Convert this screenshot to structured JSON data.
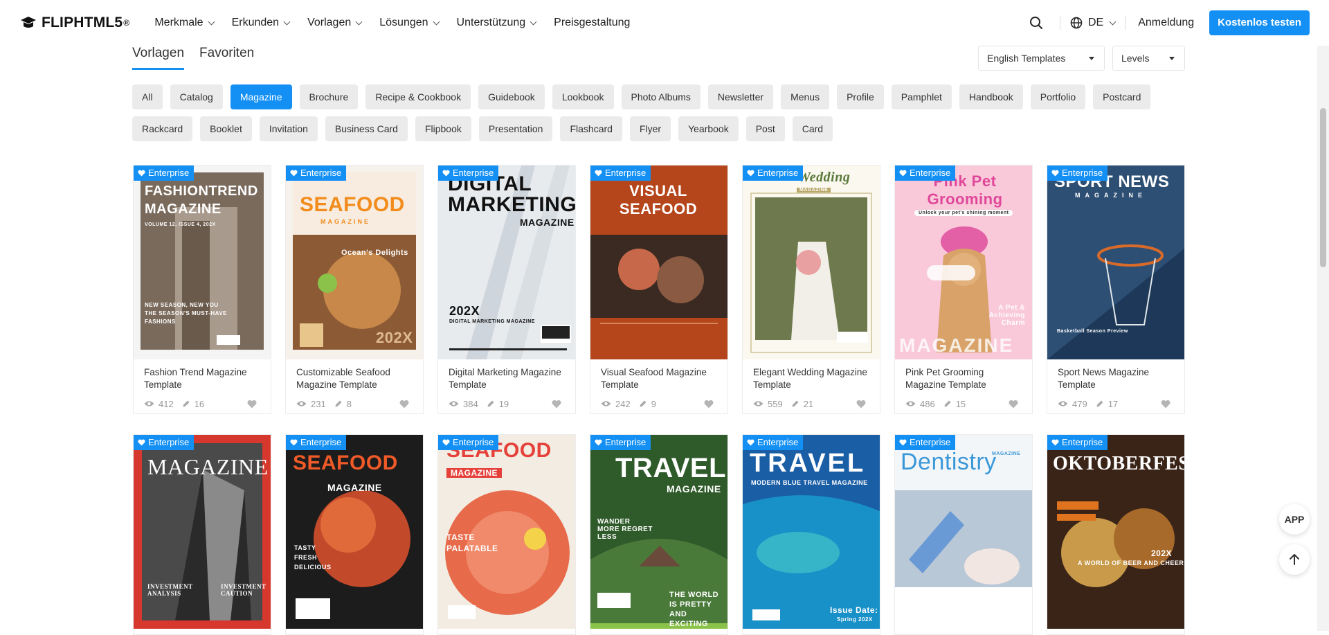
{
  "header": {
    "logo_text": "FLIPHTML5",
    "logo_mark": "®",
    "nav": [
      {
        "label": "Merkmale",
        "has_menu": true
      },
      {
        "label": "Erkunden",
        "has_menu": true
      },
      {
        "label": "Vorlagen",
        "has_menu": true
      },
      {
        "label": "Lösungen",
        "has_menu": true
      },
      {
        "label": "Unterstützung",
        "has_menu": true
      },
      {
        "label": "Preisgestaltung",
        "has_menu": false
      }
    ],
    "language": "DE",
    "login": "Anmeldung",
    "cta": "Kostenlos testen"
  },
  "tabs": [
    {
      "label": "Vorlagen",
      "active": true
    },
    {
      "label": "Favoriten",
      "active": false
    }
  ],
  "filters": {
    "language": "English Templates",
    "levels": "Levels"
  },
  "categories_row1": [
    "All",
    "Catalog",
    "Magazine",
    "Brochure",
    "Recipe & Cookbook",
    "Guidebook",
    "Lookbook",
    "Photo Albums",
    "Newsletter",
    "Menus",
    "Profile",
    "Pamphlet",
    "Handbook",
    "Portfolio",
    "Postcard"
  ],
  "categories_row2": [
    "Rackcard",
    "Booklet",
    "Invitation",
    "Business Card",
    "Flipbook",
    "Presentation",
    "Flashcard",
    "Flyer",
    "Yearbook",
    "Post",
    "Card"
  ],
  "active_category": "Magazine",
  "badge_label": "Enterprise",
  "cards_row1": [
    {
      "title": "Fashion Trend Magazine Template",
      "views": "412",
      "edits": "16"
    },
    {
      "title": "Customizable Seafood Magazine Template",
      "views": "231",
      "edits": "8"
    },
    {
      "title": "Digital Marketing Magazine Template",
      "views": "384",
      "edits": "19"
    },
    {
      "title": "Visual Seafood Magazine Template",
      "views": "242",
      "edits": "9"
    },
    {
      "title": "Elegant Wedding Magazine Template",
      "views": "559",
      "edits": "21"
    },
    {
      "title": "Pink Pet Grooming Magazine Template",
      "views": "486",
      "edits": "15"
    },
    {
      "title": "Sport News Magazine Template",
      "views": "479",
      "edits": "17"
    }
  ],
  "covers_row1": [
    {
      "headline": "FASHIONTREND",
      "sub": "MAGAZINE",
      "line": "VOLUME 12, ISSUE 4, 202X",
      "footer": "NEW SEASON, NEW YOU THE SEASON'S MUST-HAVE FASHIONS"
    },
    {
      "headline": "SEAFOOD",
      "sub": "MAGAZINE",
      "line": "Ocean's Delights",
      "footer": "202X"
    },
    {
      "headline": "DIGITAL MARKETING",
      "sub": "MAGAZINE",
      "line": "202X",
      "footer": "DIGITAL MARKETING MAGAZINE"
    },
    {
      "headline": "VISUAL SEAFOOD",
      "sub": "",
      "line": "",
      "footer": ""
    },
    {
      "headline": "Wedding",
      "sub": "MAGAZINE",
      "line": "",
      "footer": ""
    },
    {
      "headline": "Pink Pet Grooming",
      "sub": "MAGAZINE",
      "line": "Unlock your pet's shining moment",
      "footer": "A Pet & Achieving Charm"
    },
    {
      "headline": "SPORT NEWS",
      "sub": "MAGAZINE",
      "line": "",
      "footer": "Basketball Season Preview"
    }
  ],
  "covers_row2": [
    {
      "headline": "MAGAZINE",
      "sub": "INVESTMENT ANALYSIS",
      "line": "INVESTMENT CAUTION"
    },
    {
      "headline": "SEAFOOD",
      "sub": "MAGAZINE",
      "line": "TASTY FRESH DELICIOUS"
    },
    {
      "headline": "SEAFOOD",
      "sub": "MAGAZINE",
      "line": "TASTE PALATABLE"
    },
    {
      "headline": "TRAVEL",
      "sub": "MAGAZINE",
      "line": "WANDER MORE REGRET LESS",
      "footer": "THE WORLD IS PRETTY AND EXCITING"
    },
    {
      "headline": "TRAVEL",
      "sub": "MODERN BLUE TRAVEL MAGAZINE",
      "line": "Issue Date:",
      "footer": "Spring 202X"
    },
    {
      "headline": "Dentistry",
      "sub": "MAGAZINE",
      "line": ""
    },
    {
      "headline": "OKTOBERFEST",
      "sub": "202X",
      "line": "A WORLD OF BEER AND CHEER"
    }
  ],
  "floating": {
    "app": "APP"
  },
  "colors": {
    "accent": "#1490f5",
    "chip_bg": "#ebebeb"
  }
}
